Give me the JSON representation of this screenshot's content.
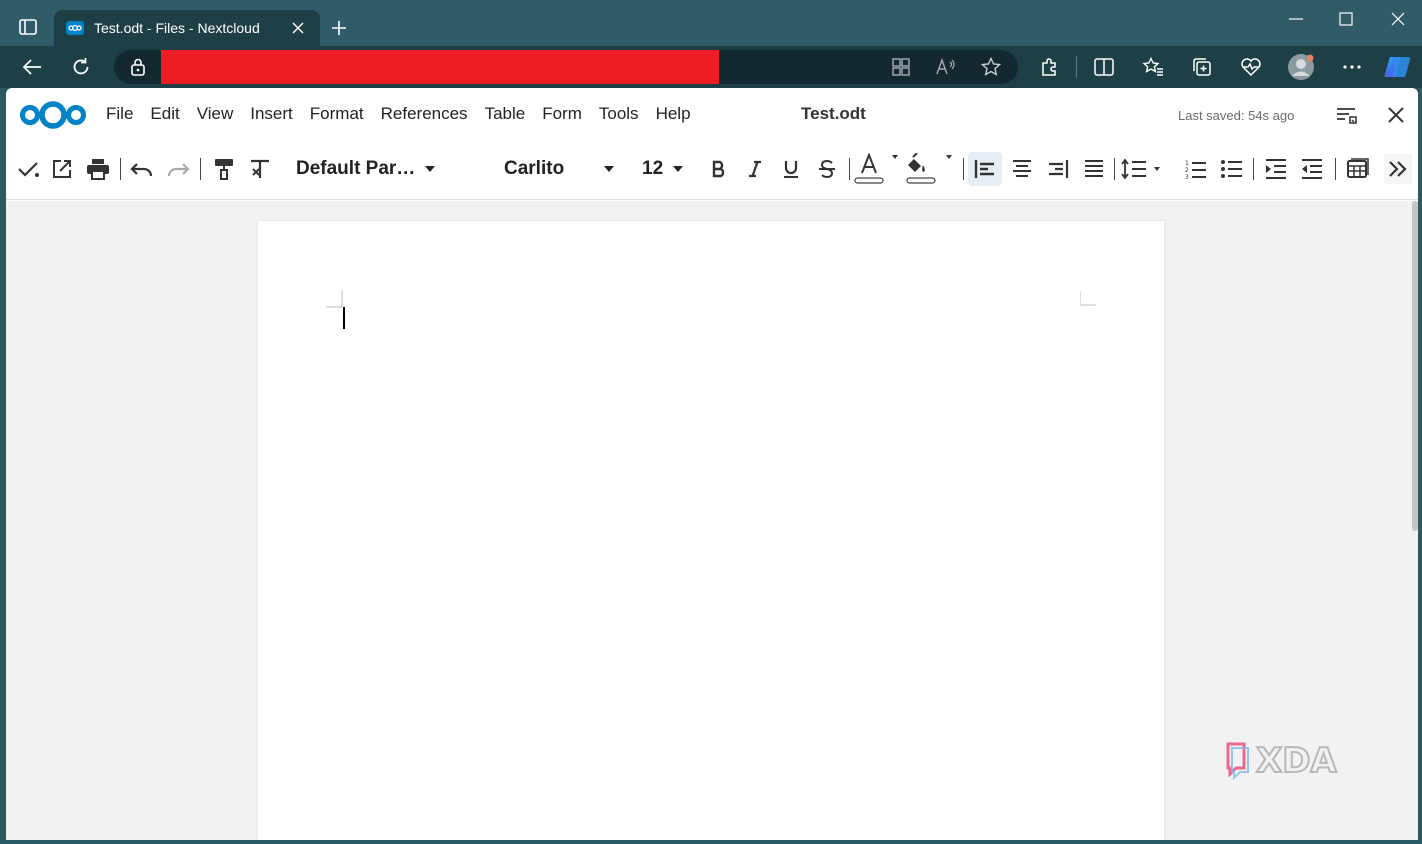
{
  "browser": {
    "tab_title": "Test.odt - Files - Nextcloud",
    "url_redacted": ""
  },
  "app": {
    "menu": [
      "File",
      "Edit",
      "View",
      "Insert",
      "Format",
      "References",
      "Table",
      "Form",
      "Tools",
      "Help"
    ],
    "document_title": "Test.odt",
    "last_saved": "Last saved: 54s ago"
  },
  "format_toolbar": {
    "paragraph_style": "Default Par…",
    "font_name": "Carlito",
    "font_size": "12"
  },
  "watermark": {
    "text": "XDA"
  },
  "colors": {
    "browser_tabstrip": "#2f5c67",
    "browser_toolbar": "#1f3f47",
    "nextcloud_blue": "#0082c9",
    "redaction_red": "#ee1c24"
  },
  "icons": {
    "browser": [
      "tab-actions-icon",
      "nextcloud-favicon",
      "close-tab-icon",
      "new-tab-icon",
      "minimize-icon",
      "maximize-icon",
      "close-window-icon",
      "back-icon",
      "reload-icon",
      "lock-icon",
      "app-available-icon",
      "read-aloud-icon",
      "favorite-star-icon",
      "extensions-icon",
      "split-screen-icon",
      "favorites-icon",
      "collections-icon",
      "browser-health-icon",
      "profile-avatar-icon",
      "more-icon",
      "copilot-icon"
    ],
    "toolbar": [
      "save-check-icon",
      "open-external-icon",
      "print-icon",
      "undo-icon",
      "redo-icon",
      "clone-formatting-icon",
      "clear-formatting-icon",
      "bold-icon",
      "italic-icon",
      "underline-icon",
      "strikethrough-icon",
      "font-color-icon",
      "highlight-color-icon",
      "align-left-icon",
      "align-center-icon",
      "align-right-icon",
      "justify-icon",
      "line-spacing-icon",
      "numbered-list-icon",
      "bullet-list-icon",
      "increase-indent-icon",
      "decrease-indent-icon",
      "insert-table-icon",
      "more-overflow-icon"
    ]
  }
}
